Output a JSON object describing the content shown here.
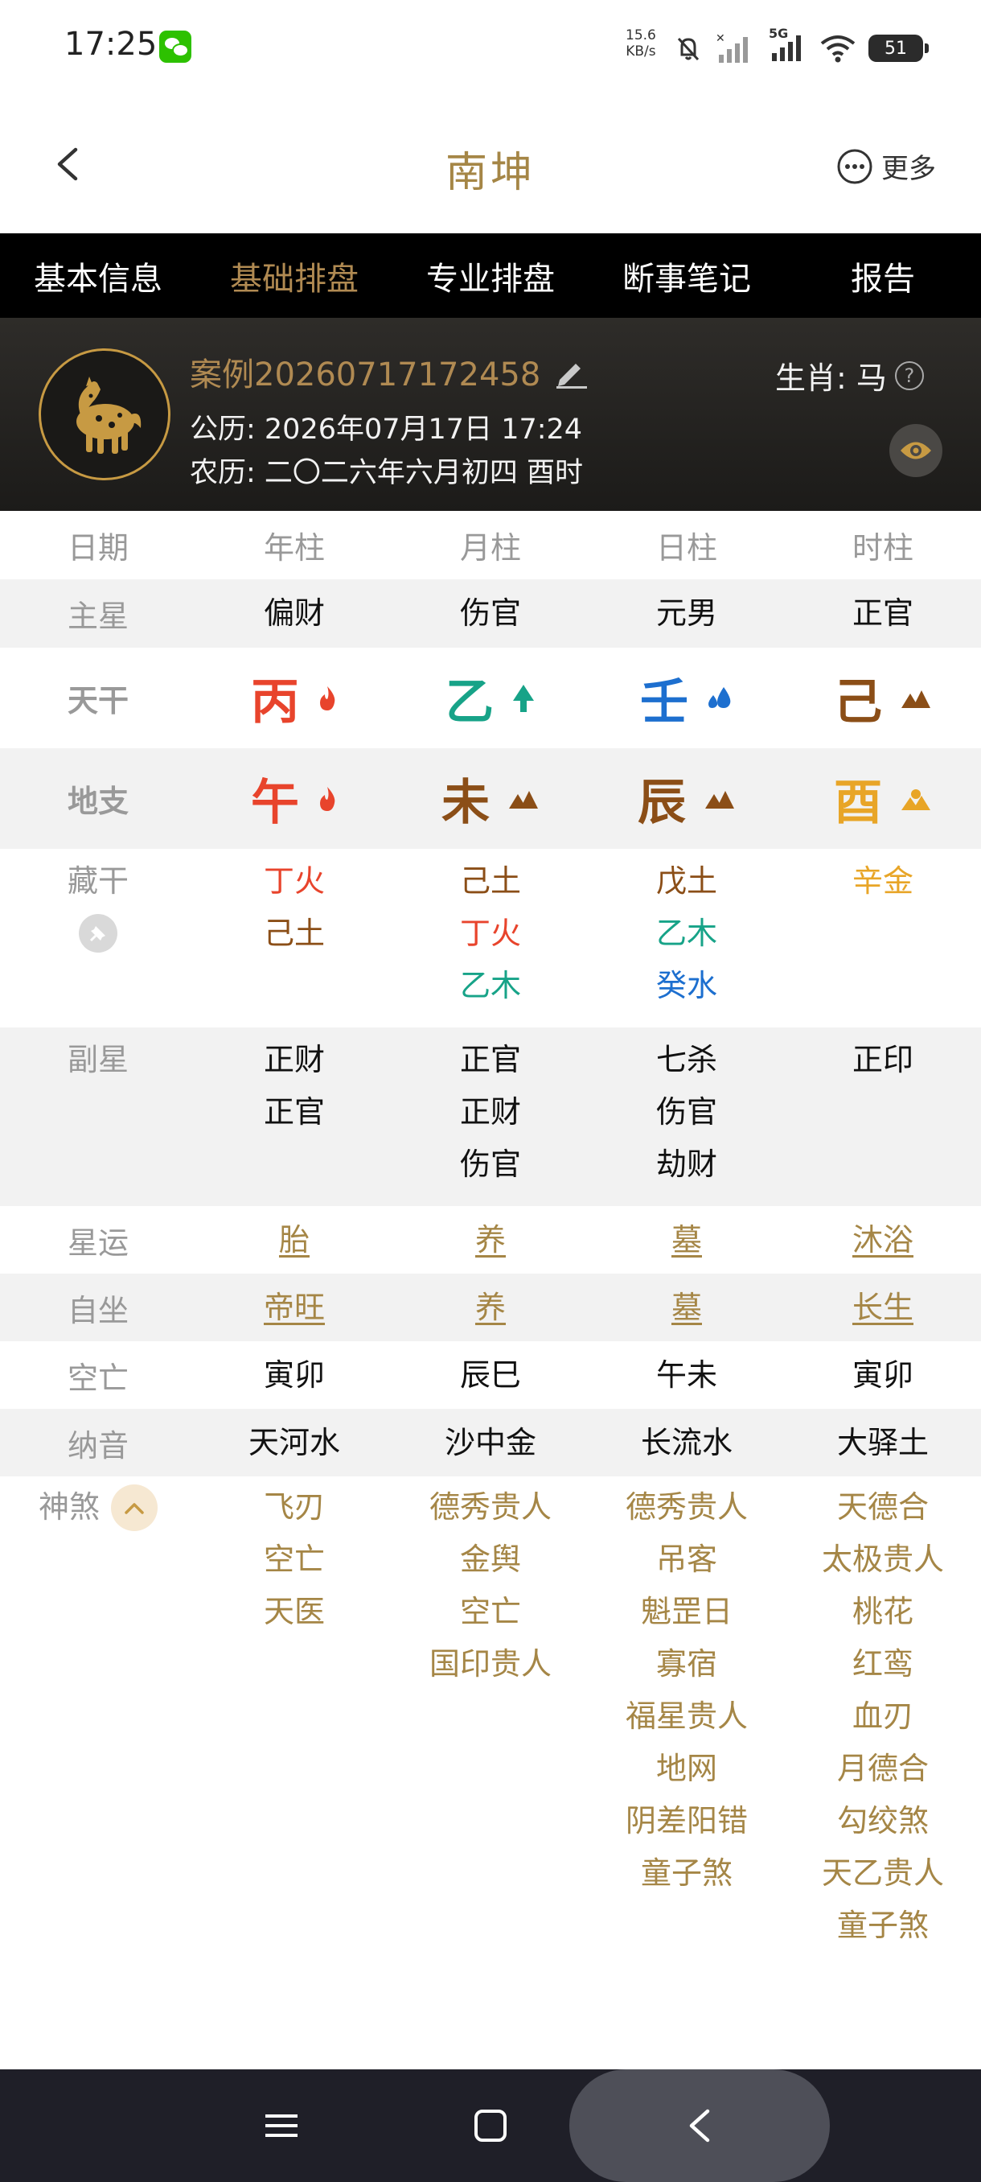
{
  "status_bar": {
    "time": "17:25",
    "speed_value": "15.6",
    "speed_unit": "KB/s",
    "network": "5G",
    "battery": "51"
  },
  "header": {
    "title": "南坤",
    "more_label": "更多"
  },
  "tabs": [
    {
      "label": "基本信息",
      "active": false
    },
    {
      "label": "基础排盘",
      "active": true
    },
    {
      "label": "专业排盘",
      "active": false
    },
    {
      "label": "断事笔记",
      "active": false
    },
    {
      "label": "报告",
      "active": false
    }
  ],
  "profile": {
    "case_name": "案例20260717172458",
    "solar": "公历: 2026年07月17日 17:24",
    "lunar": "农历: 二〇二六年六月初四  酉时",
    "zodiac": "生肖: 马"
  },
  "table": {
    "headers": [
      "日期",
      "年柱",
      "月柱",
      "日柱",
      "时柱"
    ],
    "main_star": {
      "label": "主星",
      "values": [
        "偏财",
        "伤官",
        "元男",
        "正官"
      ]
    },
    "tiangan": {
      "label": "天干",
      "values": [
        "丙",
        "乙",
        "壬",
        "己"
      ],
      "elements": [
        "fire",
        "wood",
        "water",
        "earth"
      ]
    },
    "dizhi": {
      "label": "地支",
      "values": [
        "午",
        "未",
        "辰",
        "酉"
      ],
      "elements": [
        "fire",
        "earth",
        "earth",
        "metal"
      ]
    },
    "canggan": {
      "label": "藏干",
      "cols": [
        [
          {
            "t": "丁火",
            "e": "fire"
          },
          {
            "t": "己土",
            "e": "earth"
          }
        ],
        [
          {
            "t": "己土",
            "e": "earth"
          },
          {
            "t": "丁火",
            "e": "fire"
          },
          {
            "t": "乙木",
            "e": "wood"
          }
        ],
        [
          {
            "t": "戊土",
            "e": "earth"
          },
          {
            "t": "乙木",
            "e": "wood"
          },
          {
            "t": "癸水",
            "e": "water"
          }
        ],
        [
          {
            "t": "辛金",
            "e": "metal"
          }
        ]
      ]
    },
    "fuxing": {
      "label": "副星",
      "cols": [
        [
          "正财",
          "正官"
        ],
        [
          "正官",
          "正财",
          "伤官"
        ],
        [
          "七杀",
          "伤官",
          "劫财"
        ],
        [
          "正印"
        ]
      ]
    },
    "xingyun": {
      "label": "星运",
      "values": [
        "胎",
        "养",
        "墓",
        "沐浴"
      ]
    },
    "zizuo": {
      "label": "自坐",
      "values": [
        "帝旺",
        "养",
        "墓",
        "长生"
      ]
    },
    "kongwang": {
      "label": "空亡",
      "values": [
        "寅卯",
        "辰巳",
        "午未",
        "寅卯"
      ]
    },
    "nayin": {
      "label": "纳音",
      "values": [
        "天河水",
        "沙中金",
        "长流水",
        "大驿土"
      ]
    },
    "shensha": {
      "label": "神煞",
      "cols": [
        [
          "飞刃",
          "空亡",
          "天医"
        ],
        [
          "德秀贵人",
          "金舆",
          "空亡",
          "国印贵人"
        ],
        [
          "德秀贵人",
          "吊客",
          "魁罡日",
          "寡宿",
          "福星贵人",
          "地网",
          "阴差阳错",
          "童子煞"
        ],
        [
          "天德合",
          "太极贵人",
          "桃花",
          "红鸾",
          "血刃",
          "月德合",
          "勾绞煞",
          "天乙贵人",
          "童子煞"
        ]
      ]
    }
  }
}
